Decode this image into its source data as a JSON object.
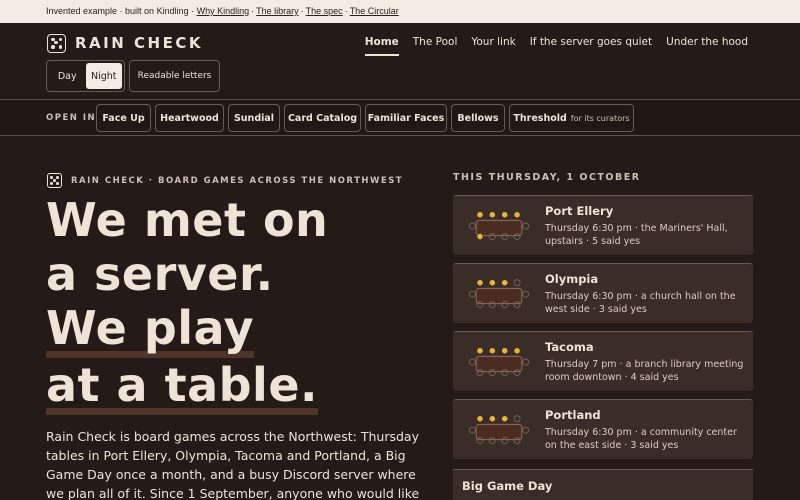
{
  "banner": {
    "prefix": "Invented example · built on Kindling ·",
    "links": [
      "Why Kindling",
      "The library",
      "The spec",
      "The Circular"
    ]
  },
  "header": {
    "brand": "RAIN CHECK",
    "nav": [
      "Home",
      "The Pool",
      "Your link",
      "If the server goes quiet",
      "Under the hood"
    ],
    "nav_active": "Home",
    "mode_options": [
      "Day",
      "Night"
    ],
    "mode_selected": "Night",
    "readable_label": "Readable letters"
  },
  "open_in": {
    "label": "OPEN IN",
    "chips": [
      "Face Up",
      "Heartwood",
      "Sundial",
      "Card Catalog",
      "Familiar Faces",
      "Bellows",
      "Threshold"
    ],
    "threshold_note": "for its curators"
  },
  "hero": {
    "eyebrow": "RAIN CHECK · BOARD GAMES ACROSS THE NORTHWEST",
    "headline_lines": [
      "We met on",
      "a server.",
      "We play",
      "at a table."
    ],
    "intro": "Rain Check is board games across the Northwest: Thursday tables in Port Ellery, Olympia, Tacoma and Portland, a Big Game Day once a month, and a busy Discord server where we plan all of it. Since 1 September, anyone who would like"
  },
  "schedule": {
    "title": "THIS THURSDAY, 1 OCTOBER",
    "cards": [
      {
        "city": "Port Ellery",
        "meta": "Thursday 6:30 pm · the Mariners' Hall, upstairs · 5 said yes",
        "yes": 5
      },
      {
        "city": "Olympia",
        "meta": "Thursday 6:30 pm · a church hall on the west side · 3 said yes",
        "yes": 3
      },
      {
        "city": "Tacoma",
        "meta": "Thursday 7 pm · a branch library meeting room downtown · 4 said yes",
        "yes": 4
      },
      {
        "city": "Portland",
        "meta": "Thursday 6:30 pm · a community center on the east side · 3 said yes",
        "yes": 3
      }
    ],
    "big_day": "Big Game Day"
  },
  "colors": {
    "background": "#241a17",
    "card": "#3a2d28",
    "seat_yes": "#e8b53a",
    "table": "#4a2c20",
    "text": "#efe3d6"
  }
}
